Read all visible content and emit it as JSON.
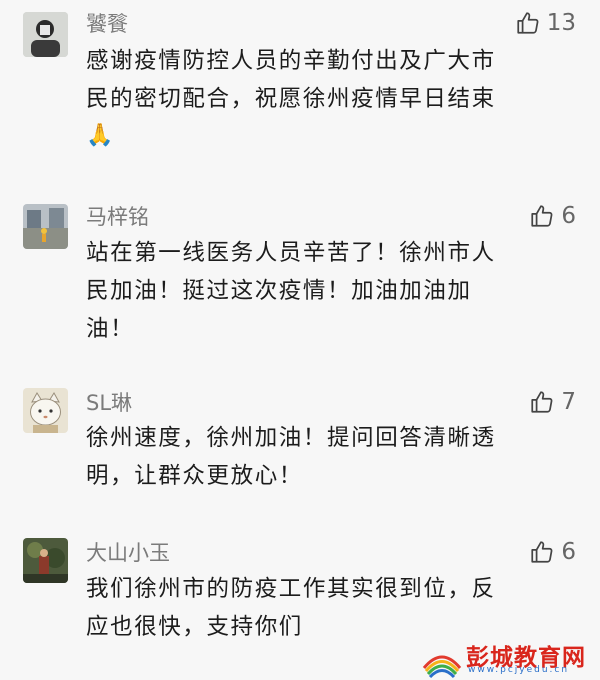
{
  "comments": [
    {
      "username": "饕餮",
      "likes": "13",
      "lines": [
        "感谢疫情防控人员的辛勤付出及广大市",
        "民的密切配合，祝愿徐州疫情早日结束"
      ],
      "emoji": "🙏"
    },
    {
      "username": "马梓铭",
      "likes": "6",
      "lines": [
        "站在第一线医务人员辛苦了！徐州市人",
        "民加油！挺过这次疫情！加油加油加",
        "油！"
      ]
    },
    {
      "username": "SL琳",
      "likes": "7",
      "lines": [
        "徐州速度，徐州加油！提问回答清晰透",
        "明，让群众更放心！"
      ]
    },
    {
      "username": "大山小玉",
      "likes": "6",
      "lines": [
        "我们徐州市的防疫工作其实很到位，反",
        "应也很快，支持你们"
      ]
    }
  ],
  "watermark": {
    "title": "彭城教育网",
    "url": "www.pcjyedu.cn"
  },
  "colors": {
    "background": "#f7f7f7",
    "username": "#7b7b7b",
    "text": "#1c1c1c",
    "watermark": "#d9261c"
  },
  "icons": [
    "avatar",
    "thumbs-up-icon",
    "folded-hands-emoji",
    "watermark-logo-icon"
  ]
}
